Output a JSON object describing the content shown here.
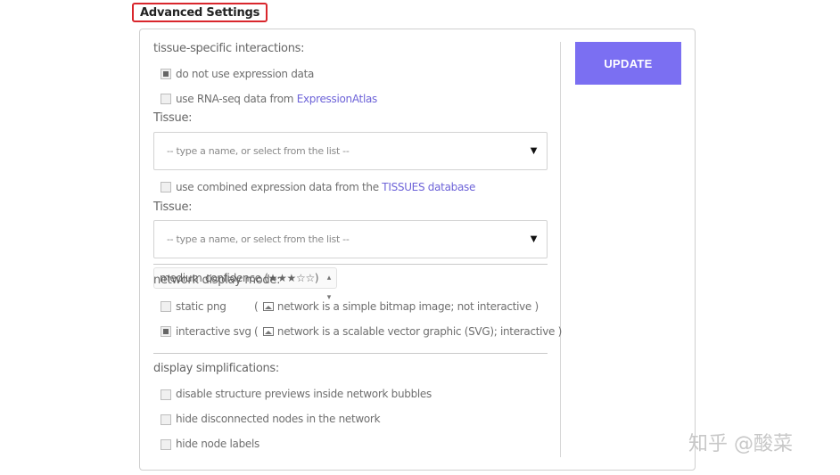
{
  "header": {
    "title": "Advanced Settings"
  },
  "update_button": {
    "label": "UPDATE",
    "color": "#7b6ff2"
  },
  "tissue_section": {
    "label": "tissue-specific interactions:",
    "options": [
      {
        "label": "do not use expression data",
        "checked": true
      },
      {
        "label_prefix": "use RNA-seq data from ",
        "link": "ExpressionAtlas",
        "checked": false
      }
    ],
    "tissue_label_1": "Tissue:",
    "select_1_placeholder": "-- type a name, or select from the list --",
    "combined_option": {
      "label_prefix": "use combined expression data from the ",
      "link": "TISSUES database",
      "checked": false
    },
    "tissue_label_2": "Tissue:",
    "select_2_placeholder": "-- type a name, or select from the list --"
  },
  "confidence_select": {
    "value": "medium confidence (★★★☆☆)"
  },
  "display_mode": {
    "label": "network display mode:",
    "options": [
      {
        "label": "static png",
        "description": "network is a simple bitmap image; not interactive",
        "checked": false
      },
      {
        "label": "interactive svg",
        "description": "network is a scalable vector graphic (SVG); interactive",
        "checked": true
      }
    ]
  },
  "simplifications": {
    "label": "display simplifications:",
    "options": [
      {
        "label": "disable structure previews inside network bubbles",
        "checked": false
      },
      {
        "label": "hide disconnected nodes in the network",
        "checked": false
      },
      {
        "label": "hide node labels",
        "checked": false
      }
    ]
  },
  "watermark": {
    "text": "知乎 @酸菜"
  }
}
